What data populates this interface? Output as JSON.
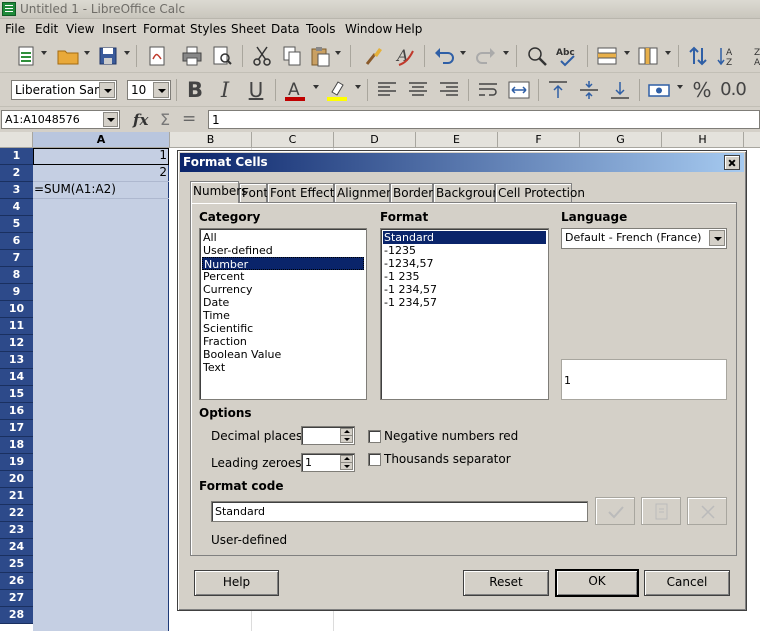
{
  "window": {
    "title": "Untitled 1 - LibreOffice Calc"
  },
  "menu": [
    "File",
    "Edit",
    "View",
    "Insert",
    "Format",
    "Styles",
    "Sheet",
    "Data",
    "Tools",
    "Window",
    "Help"
  ],
  "toolbar": {
    "font_name": "Liberation Sans",
    "font_size": "10",
    "bold_glyph": "B",
    "italic_glyph": "I",
    "underline_glyph": "U",
    "percent_glyph": "%",
    "decimal_glyph": "0.0",
    "font_color": "#c00000",
    "highlight_color": "#ffff00"
  },
  "formula_bar": {
    "name_box": "A1:A1048576",
    "fx": "fx",
    "sigma": "Σ",
    "equals": "=",
    "content": "1"
  },
  "sheet": {
    "columns": [
      "A",
      "B",
      "C",
      "D",
      "E",
      "F",
      "G",
      "H"
    ],
    "rows": [
      "1",
      "2",
      "3",
      "4",
      "5",
      "6",
      "7",
      "8",
      "9",
      "10",
      "11",
      "12",
      "13",
      "14",
      "15",
      "16",
      "17",
      "18",
      "19",
      "20",
      "21",
      "22",
      "23",
      "24",
      "25",
      "26",
      "27",
      "28"
    ],
    "cells": {
      "A1": "1",
      "A2": "2",
      "A3": "=SUM(A1:A2)"
    }
  },
  "dialog": {
    "title": "Format Cells",
    "tabs": [
      "Numbers",
      "Font",
      "Font Effects",
      "Alignment",
      "Borders",
      "Background",
      "Cell Protection"
    ],
    "category_label": "Category",
    "categories": [
      "All",
      "User-defined",
      "Number",
      "Percent",
      "Currency",
      "Date",
      "Time",
      "Scientific",
      "Fraction",
      "Boolean Value",
      "Text"
    ],
    "format_label": "Format",
    "formats": [
      "Standard",
      "-1235",
      "-1234,57",
      "-1 235",
      "-1 234,57",
      "-1 234,57"
    ],
    "language_label": "Language",
    "language_value": "Default - French (France)",
    "preview_value": "1",
    "options_label": "Options",
    "decimal_places_label": "Decimal places:",
    "decimal_places_value": "",
    "leading_zeroes_label": "Leading zeroes:",
    "leading_zeroes_value": "1",
    "negative_red_label": "Negative numbers red",
    "thousands_sep_label": "Thousands separator",
    "format_code_label": "Format code",
    "format_code_value": "Standard",
    "status_text": "User-defined",
    "buttons": {
      "help": "Help",
      "reset": "Reset",
      "ok": "OK",
      "cancel": "Cancel"
    }
  }
}
